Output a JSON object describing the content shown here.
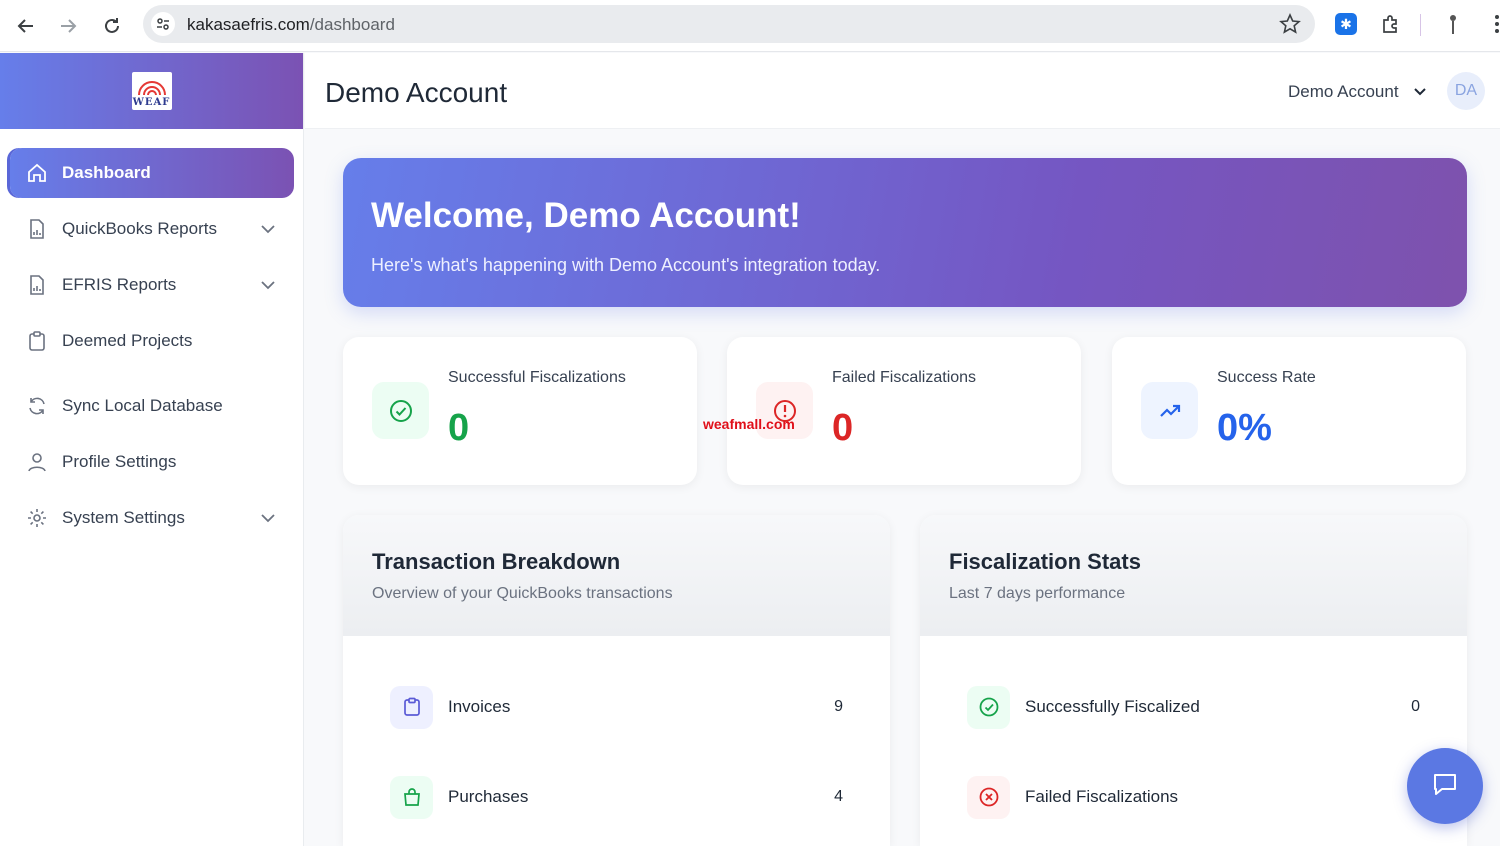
{
  "browser": {
    "url_host": "kakasaefris.com",
    "url_path": "/dashboard"
  },
  "sidebar": {
    "logo_text": "WEAF",
    "items": [
      {
        "label": "Dashboard",
        "icon": "home-icon",
        "active": true
      },
      {
        "label": "QuickBooks Reports",
        "icon": "report-icon",
        "has_submenu": true
      },
      {
        "label": "EFRIS Reports",
        "icon": "report-icon",
        "has_submenu": true
      },
      {
        "label": "Deemed Projects",
        "icon": "clipboard-icon"
      },
      {
        "label": "Sync Local Database",
        "icon": "sync-icon"
      },
      {
        "label": "Profile Settings",
        "icon": "user-icon"
      },
      {
        "label": "System Settings",
        "icon": "gear-icon",
        "has_submenu": true
      }
    ]
  },
  "header": {
    "title": "Demo Account",
    "user_name": "Demo Account",
    "avatar_initials": "DA"
  },
  "welcome": {
    "heading": "Welcome, Demo Account!",
    "subtext": "Here's what's happening with Demo Account's integration today."
  },
  "stats": [
    {
      "label": "Successful Fiscalizations",
      "value": "0",
      "color": "#16a34a",
      "icon": "check-circle-icon"
    },
    {
      "label": "Failed Fiscalizations",
      "value": "0",
      "color": "#dc2626",
      "icon": "alert-circle-icon"
    },
    {
      "label": "Success Rate",
      "value": "0%",
      "color": "#2563eb",
      "icon": "trending-up-icon"
    }
  ],
  "watermark": "weafmall.com",
  "transactions": {
    "title": "Transaction Breakdown",
    "subtitle": "Overview of your QuickBooks transactions",
    "rows": [
      {
        "label": "Invoices",
        "value": "9",
        "icon": "clipboard-icon"
      },
      {
        "label": "Purchases",
        "value": "4",
        "icon": "shopping-bag-icon"
      }
    ]
  },
  "fiscal": {
    "title": "Fiscalization Stats",
    "subtitle": "Last 7 days performance",
    "rows": [
      {
        "label": "Successfully Fiscalized",
        "value": "0",
        "icon": "check-circle-icon"
      },
      {
        "label": "Failed Fiscalizations",
        "value": "",
        "icon": "x-circle-icon"
      }
    ]
  },
  "colors": {
    "brand_gradient_start": "#667eea",
    "brand_gradient_end": "#7b52b3",
    "success": "#16a34a",
    "danger": "#dc2626",
    "info": "#2563eb"
  }
}
